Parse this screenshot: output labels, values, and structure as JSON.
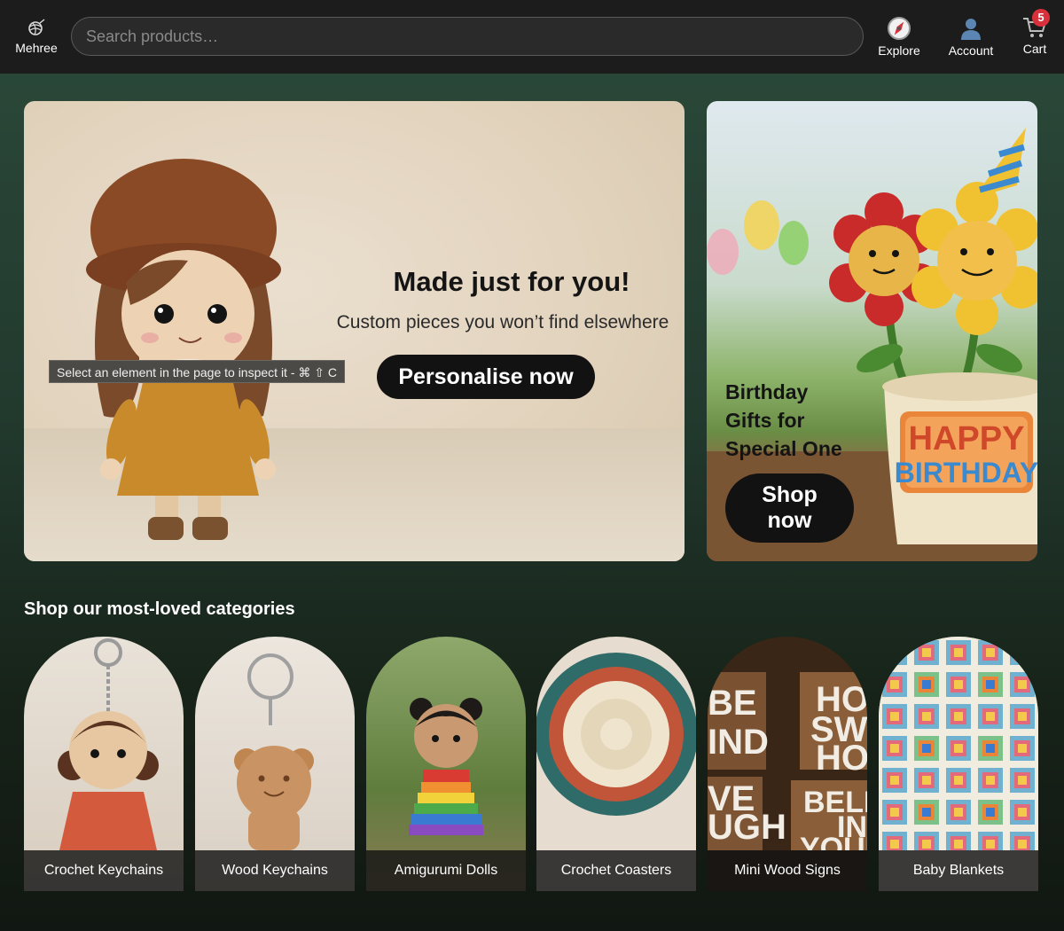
{
  "header": {
    "brand": "Mehree",
    "search_placeholder": "Search products…",
    "nav": {
      "explore": "Explore",
      "account": "Account",
      "cart": "Cart",
      "cart_count": "5"
    }
  },
  "hero": {
    "title": "Made just for you!",
    "subtitle": "Custom pieces you won’t find elsewhere",
    "button": "Personalise now",
    "inspect_tip": "Select an element in the page to inspect it - ⌘ ⇧ C"
  },
  "side_promo": {
    "title_line1": "Birthday",
    "title_line2": "Gifts for",
    "title_line3": "Special One",
    "button_line1": "Shop",
    "button_line2": "now",
    "pot_text_line1": "HAPPY",
    "pot_text_line2": "BIRTHDAY"
  },
  "categories": {
    "heading": "Shop our most-loved categories",
    "items": [
      {
        "label": "Crochet Keychains"
      },
      {
        "label": "Wood Keychains"
      },
      {
        "label": "Amigurumi Dolls"
      },
      {
        "label": "Crochet Coasters"
      },
      {
        "label": "Mini Wood Signs"
      },
      {
        "label": "Baby Blankets"
      }
    ],
    "sign_words": [
      "BE",
      "IND",
      "HOM",
      "SWE",
      "HOM",
      "VE",
      "UGH",
      "BELIE",
      "IN",
      "YOURS"
    ]
  },
  "colors": {
    "header_bg": "#1c1c1c",
    "page_bg_top": "#2b4a3a",
    "page_bg_bottom": "#111712",
    "button_bg": "#121212",
    "badge": "#d8313b"
  }
}
